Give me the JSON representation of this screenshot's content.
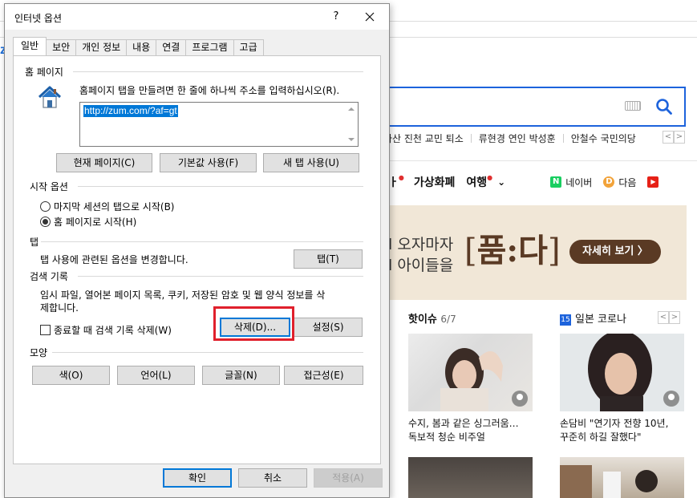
{
  "browser_bg": {
    "logo": "z",
    "keywords": [
      "아산 진천 교민 퇴소",
      "류현경 연인 박성훈",
      "안철수 국민의당"
    ],
    "nav_items": [
      "가상화폐",
      "여행"
    ],
    "nav_prev_label": "·",
    "portals": [
      {
        "label": "네이버",
        "icon": "N",
        "color": "#19ce60"
      },
      {
        "label": "다음",
        "icon": "D",
        "color": "#f2a33a"
      },
      {
        "label": "",
        "icon": "▶",
        "color": "#e62117"
      }
    ],
    "banner": {
      "line1": "l 오자마자",
      "line2": "l 아이들을",
      "logo": "[품:다]",
      "button": "자세히 보기 〉"
    },
    "hot": {
      "title": "핫이슈",
      "count": "6/7"
    },
    "corona": {
      "badge": "15",
      "title": "일본 코로나"
    },
    "news": [
      {
        "line1": "수지, 봄과 같은 싱그러움…",
        "line2": "독보적 청순 비주얼"
      },
      {
        "line1": "손담비 \"연기자 전향 10년,",
        "line2": "꾸준히 하길 잘했다\""
      }
    ]
  },
  "dialog": {
    "title": "인터넷 옵션",
    "help": "?",
    "tabs": [
      "일반",
      "보안",
      "개인 정보",
      "내용",
      "연결",
      "프로그램",
      "고급"
    ],
    "home": {
      "heading": "홈 페이지",
      "description": "홈페이지 탭을 만들려면 한 줄에 하나씩 주소를 입력하십시오(R).",
      "url": "http://zum.com/?af=gt",
      "buttons": [
        "현재 페이지(C)",
        "기본값 사용(F)",
        "새 탭 사용(U)"
      ]
    },
    "startup": {
      "heading": "시작 옵션",
      "option1": "마지막 세션의 탭으로 시작(B)",
      "option2": "홈 페이지로 시작(H)",
      "selected": 2
    },
    "tabs_group": {
      "heading": "탭",
      "description": "탭 사용에 관련된 옵션을 변경합니다.",
      "button": "탭(T)"
    },
    "history": {
      "heading": "검색 기록",
      "line1": "임시 파일, 열어본 페이지 목록, 쿠키, 저장된 암호 및 웹 양식 정보를 삭",
      "line2": "제합니다.",
      "checkbox": "종료할 때 검색 기록 삭제(W)",
      "checked": false,
      "delete_button": "삭제(D)...",
      "settings_button": "설정(S)"
    },
    "appearance": {
      "heading": "모양",
      "buttons": [
        "색(O)",
        "언어(L)",
        "글꼴(N)",
        "접근성(E)"
      ]
    },
    "footer": {
      "ok": "확인",
      "cancel": "취소",
      "apply": "적용(A)"
    }
  },
  "highlight_color": "#e0202c"
}
